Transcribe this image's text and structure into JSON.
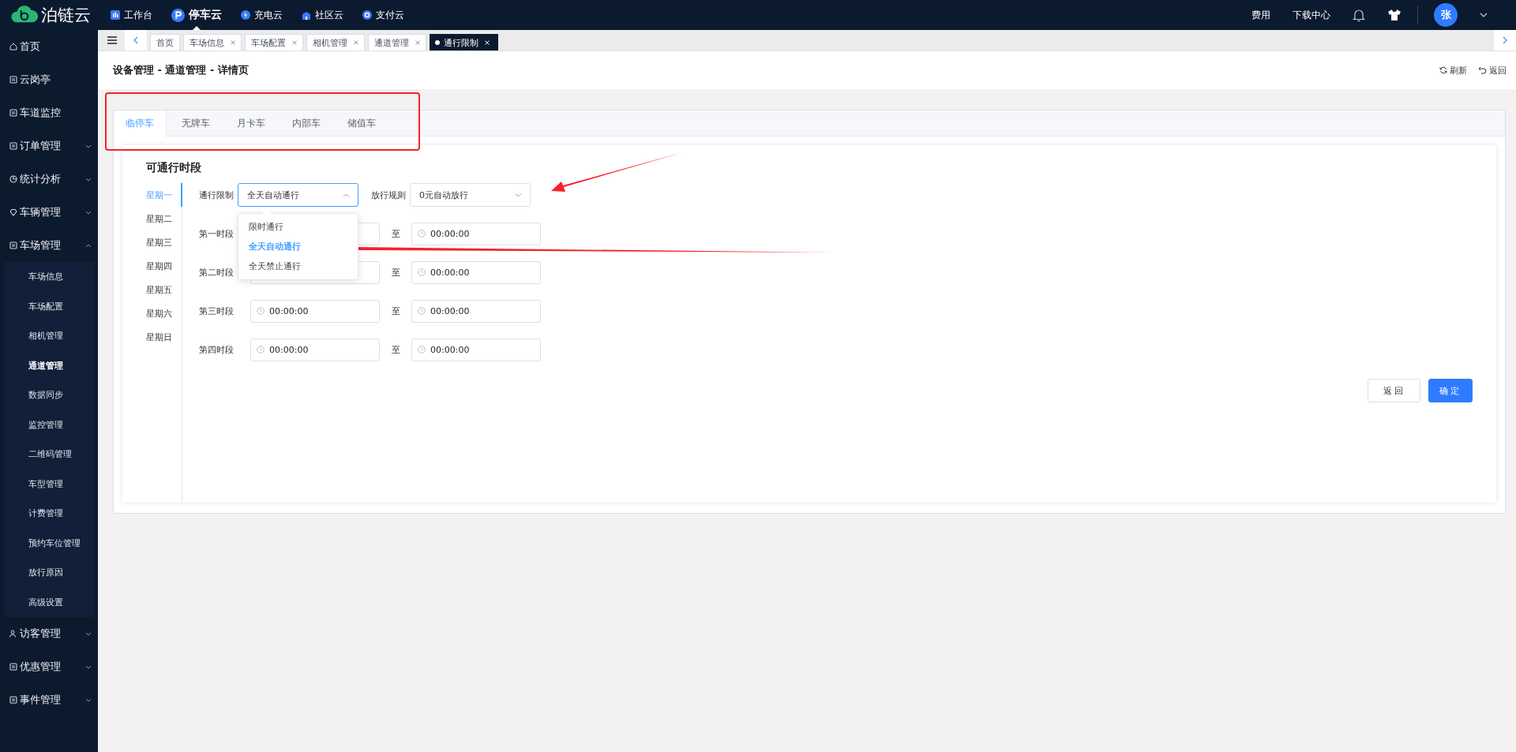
{
  "brand": {
    "name": "泊链云"
  },
  "top_nav": [
    {
      "label": "工作台",
      "selected": false
    },
    {
      "label": "停车云",
      "selected": true
    },
    {
      "label": "充电云",
      "selected": false
    },
    {
      "label": "社区云",
      "selected": false
    },
    {
      "label": "支付云",
      "selected": false
    }
  ],
  "header_links": [
    {
      "label": "费用"
    },
    {
      "label": "下载中心"
    }
  ],
  "user": {
    "avatar": "张"
  },
  "sidebar": {
    "items": [
      {
        "label": "首页",
        "kind": "link"
      },
      {
        "label": "云岗亭",
        "kind": "link"
      },
      {
        "label": "车道监控",
        "kind": "link"
      },
      {
        "label": "订单管理",
        "kind": "group",
        "expanded": false
      },
      {
        "label": "统计分析",
        "kind": "group",
        "expanded": false
      },
      {
        "label": "车辆管理",
        "kind": "group",
        "expanded": false
      },
      {
        "label": "车场管理",
        "kind": "group",
        "expanded": true,
        "children": [
          {
            "label": "车场信息",
            "selected": false
          },
          {
            "label": "车场配置",
            "selected": false
          },
          {
            "label": "相机管理",
            "selected": false
          },
          {
            "label": "通道管理",
            "selected": true
          },
          {
            "label": "数据同步",
            "selected": false
          },
          {
            "label": "监控管理",
            "selected": false
          },
          {
            "label": "二维码管理",
            "selected": false
          },
          {
            "label": "车型管理",
            "selected": false
          },
          {
            "label": "计费管理",
            "selected": false
          },
          {
            "label": "预约车位管理",
            "selected": false
          },
          {
            "label": "放行原因",
            "selected": false
          },
          {
            "label": "高级设置",
            "selected": false
          }
        ]
      },
      {
        "label": "访客管理",
        "kind": "group",
        "expanded": false
      },
      {
        "label": "优惠管理",
        "kind": "group",
        "expanded": false
      },
      {
        "label": "事件管理",
        "kind": "group",
        "expanded": false
      }
    ]
  },
  "open_tabs": [
    {
      "label": "首页",
      "closable": false,
      "selected": false
    },
    {
      "label": "车场信息",
      "closable": true,
      "selected": false
    },
    {
      "label": "车场配置",
      "closable": true,
      "selected": false
    },
    {
      "label": "相机管理",
      "closable": true,
      "selected": false
    },
    {
      "label": "通道管理",
      "closable": true,
      "selected": false
    },
    {
      "label": "通行限制",
      "closable": true,
      "selected": true
    }
  ],
  "page": {
    "title": "设备管理 - 通道管理 - 详情页",
    "actions": [
      {
        "label": "刷新",
        "kind": "refresh"
      },
      {
        "label": "返回",
        "kind": "back"
      }
    ]
  },
  "vehicle_tabs": [
    {
      "label": "临停车",
      "selected": true
    },
    {
      "label": "无牌车",
      "selected": false
    },
    {
      "label": "月卡车",
      "selected": false
    },
    {
      "label": "内部车",
      "selected": false
    },
    {
      "label": "储值车",
      "selected": false
    }
  ],
  "section_title": "可通行时段",
  "days": [
    {
      "label": "星期一",
      "selected": true
    },
    {
      "label": "星期二",
      "selected": false
    },
    {
      "label": "星期三",
      "selected": false
    },
    {
      "label": "星期四",
      "selected": false
    },
    {
      "label": "星期五",
      "selected": false
    },
    {
      "label": "星期六",
      "selected": false
    },
    {
      "label": "星期日",
      "selected": false
    }
  ],
  "access_limit": {
    "label": "通行限制",
    "value": "全天自动通行",
    "expanded": true,
    "options": [
      {
        "label": "限时通行",
        "selected": false
      },
      {
        "label": "全天自动通行",
        "selected": true
      },
      {
        "label": "全天禁止通行",
        "selected": false
      }
    ]
  },
  "release_rule": {
    "label": "放行规则",
    "value": "0元自动放行",
    "expanded": false
  },
  "periods": [
    {
      "label": "第一时段",
      "separator": "至",
      "end": "00:00:00"
    },
    {
      "label": "第二时段",
      "separator": "至",
      "end": "00:00:00"
    },
    {
      "label": "第三时段",
      "start": "00:00:00",
      "separator": "至",
      "end": "00:00:00"
    },
    {
      "label": "第四时段",
      "start": "00:00:00",
      "separator": "至",
      "end": "00:00:00"
    }
  ],
  "buttons": [
    {
      "label": "返回",
      "kind": "secondary"
    },
    {
      "label": "确定",
      "kind": "primary"
    }
  ]
}
